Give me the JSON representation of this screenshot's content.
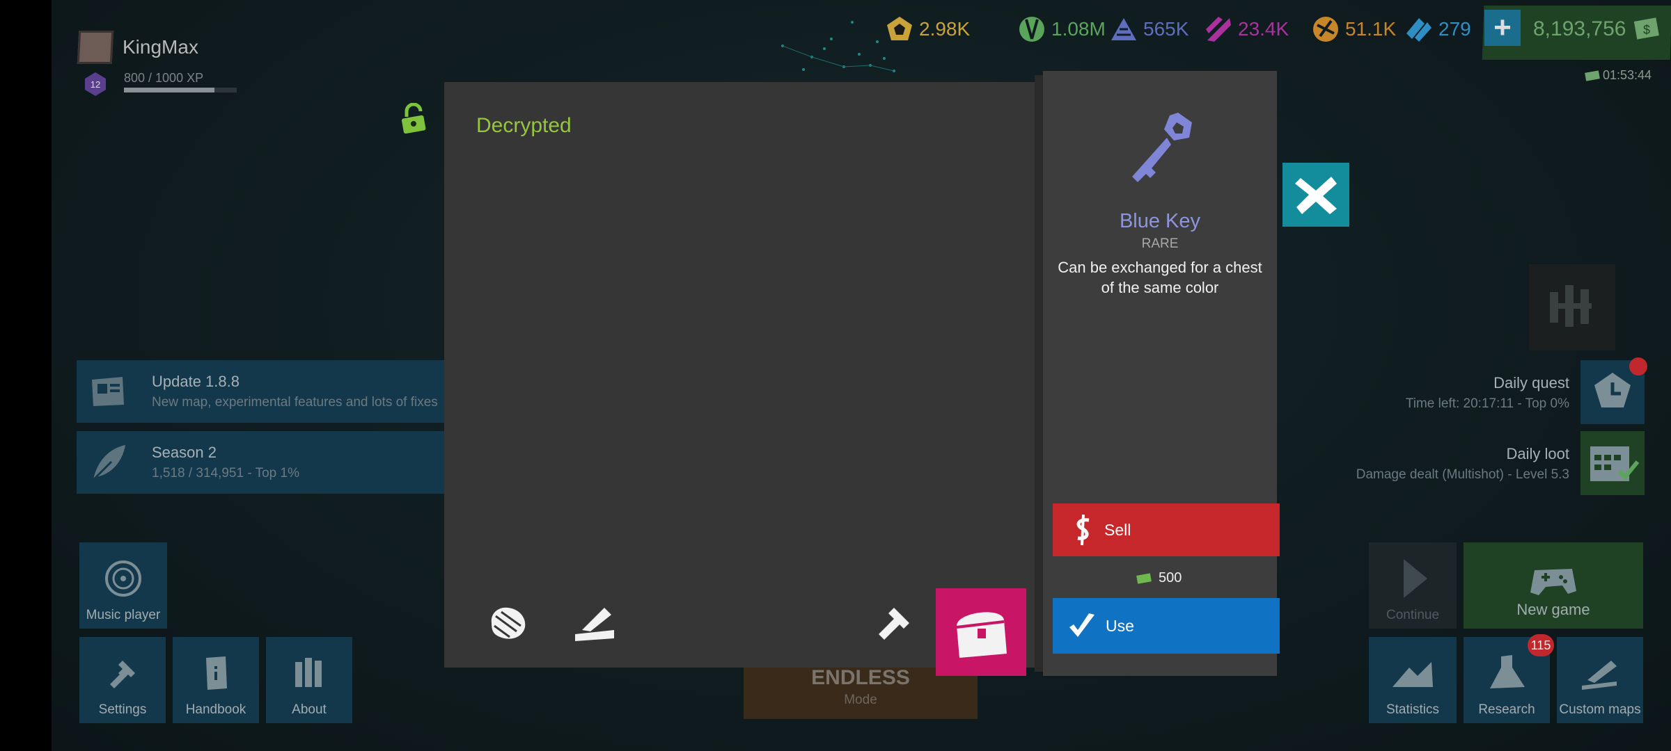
{
  "profile": {
    "username": "KingMax",
    "level": "12",
    "xp": "800 / 1000 XP",
    "xp_fraction": 0.8
  },
  "resources": [
    {
      "icon": "pentagon-coin-icon",
      "value": "2.98K",
      "color": "#c9a23a"
    },
    {
      "icon": "green-gem-icon",
      "value": "1.08M",
      "color": "#5aa55b"
    },
    {
      "icon": "blue-crystal-icon",
      "value": "565K",
      "color": "#5e6dbf"
    },
    {
      "icon": "purple-shard-icon",
      "value": "23.4K",
      "color": "#a9329e"
    },
    {
      "icon": "orange-ore-icon",
      "value": "51.1K",
      "color": "#c7862a"
    },
    {
      "icon": "cyan-diamond-icon",
      "value": "279",
      "color": "#2d8fc4"
    }
  ],
  "money": {
    "value": "8,193,756",
    "timer": "01:53:44"
  },
  "announcements": [
    {
      "title": "Update 1.8.8",
      "subtitle": "New map, experimental features and lots of fixes"
    },
    {
      "title": "Season 2",
      "subtitle": "1,518 / 314,951 - Top 1%"
    }
  ],
  "bottom_left": {
    "music": "Music player",
    "settings": "Settings",
    "handbook": "Handbook",
    "about": "About"
  },
  "right_panel": {
    "daily_quest": {
      "title": "Daily quest",
      "subtitle": "Time left: 20:17:11 - Top 0%"
    },
    "daily_loot": {
      "title": "Daily loot",
      "subtitle": "Damage dealt (Multishot) - Level 5.3"
    },
    "continue": "Continue",
    "new_game": "New game",
    "statistics": "Statistics",
    "research": "Research",
    "research_badge": "115",
    "custom_maps": "Custom maps"
  },
  "modal": {
    "title": "Decrypted",
    "item_name": "Blue Key",
    "item_rarity": "RARE",
    "item_description": "Can be exchanged for a chest of the same color",
    "sell_label": "Sell",
    "sell_price": "500",
    "use_label": "Use"
  },
  "mode": {
    "name": "ENDLESS",
    "label": "Mode"
  },
  "colors": {
    "accent_green": "#96c63e",
    "sell_red": "#c6272a",
    "use_blue": "#1072c2",
    "chest_pink": "#c81566",
    "close_teal": "#138d9b"
  }
}
